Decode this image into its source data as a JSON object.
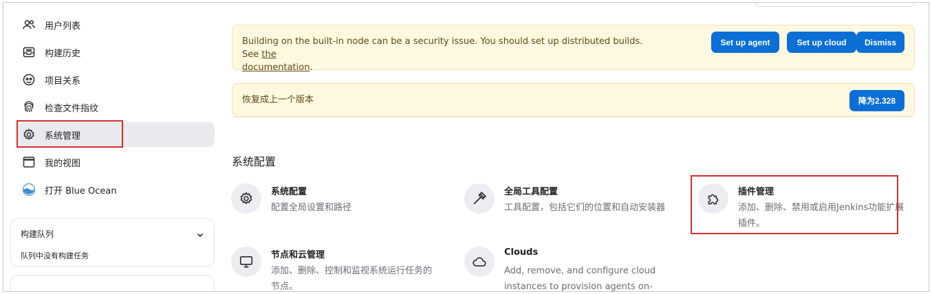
{
  "sidebar": {
    "items": [
      {
        "label": "用户列表",
        "icon": "users-icon"
      },
      {
        "label": "构建历史",
        "icon": "inbox-icon"
      },
      {
        "label": "项目关系",
        "icon": "relationship-icon"
      },
      {
        "label": "检查文件指纹",
        "icon": "fingerprint-icon"
      },
      {
        "label": "系统管理",
        "icon": "gear-icon"
      },
      {
        "label": "我的视图",
        "icon": "window-icon"
      },
      {
        "label": "打开 Blue Ocean",
        "icon": "blue-ocean-icon"
      }
    ],
    "build_queue": {
      "title": "构建队列",
      "empty": "队列中没有构建任务"
    }
  },
  "alerts": {
    "security": {
      "text": "Building on the built-in node can be a security issue. You should set up distributed builds. See ",
      "link_part1": "the",
      "link_part2": "documentation",
      "after": ".",
      "buttons": {
        "agent": "Set up agent",
        "cloud": "Set up cloud",
        "dismiss": "Dismiss"
      }
    },
    "downgrade": {
      "text": "恢复成上一个版本",
      "button": "降为2.328"
    }
  },
  "section": {
    "title": "系统配置",
    "tiles": [
      {
        "title": "系统配置",
        "desc": "配置全局设置和路径",
        "icon": "gear-icon"
      },
      {
        "title": "全局工具配置",
        "desc": "工具配置，包括它们的位置和自动安装器",
        "icon": "hammer-icon"
      },
      {
        "title": "插件管理",
        "desc_l1": "添加、删除、禁用或启用Jenkins功能扩展",
        "desc_l2": "插件。",
        "icon": "puzzle-icon"
      },
      {
        "title": "节点和云管理",
        "desc_l1": "添加、删除、控制和监视系统运行任务的",
        "desc_l2": "节点。",
        "icon": "monitor-icon"
      },
      {
        "title": "Clouds",
        "desc_l1": "Add, remove, and configure cloud",
        "desc_l2": "instances to provision agents on-",
        "icon": "cloud-icon"
      }
    ]
  },
  "colors": {
    "accent": "#0b6fd6",
    "alert_bg": "#fef8e1",
    "highlight": "#d62b2b"
  }
}
